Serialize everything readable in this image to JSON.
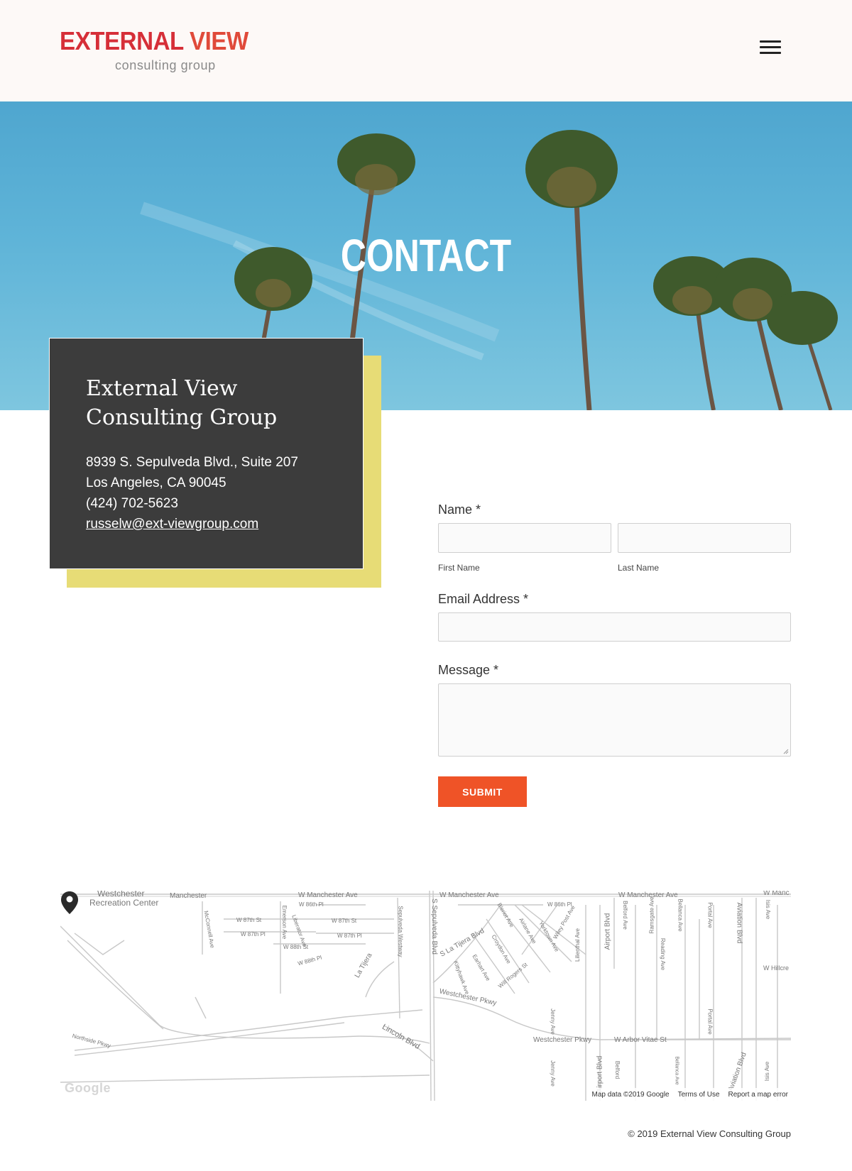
{
  "header": {
    "logo_text_1": "EXTERNAL",
    "logo_text_2": "VIEW",
    "logo_subtitle": "consulting group",
    "menu_icon": "hamburger-menu-icon"
  },
  "hero": {
    "title": "CONTACT"
  },
  "info_card": {
    "title": "External View Consulting Group",
    "address_line_1": "8939 S. Sepulveda Blvd., Suite 207",
    "address_line_2": "Los Angeles, CA 90045",
    "phone": "(424) 702-5623",
    "email": "russelw@ext-viewgroup.com"
  },
  "form": {
    "name_label": "Name *",
    "first_name_label": "First Name",
    "last_name_label": "Last Name",
    "email_label": "Email Address *",
    "message_label": "Message *",
    "submit_label": "SUBMIT"
  },
  "map": {
    "google_logo": "Google",
    "attribution": [
      "Map data ©2019 Google",
      "Terms of Use",
      "Report a map error"
    ],
    "pin_icon": "map-pin-icon",
    "labels": {
      "westchester_rec": "Westchester",
      "rec_center": "Recreation Center",
      "manchester": "Manchester",
      "w_manchester_1": "W Manchester Ave",
      "w_manchester_2": "W Manchester Ave",
      "w_manchester_3": "W Manchester Ave",
      "w_manc": "W Manc",
      "w_86th_pl_1": "W 86th Pl",
      "w_86th_pl_2": "W 86th Pl",
      "w_87th_st_1": "W 87th St",
      "w_87th_pl_1": "W 87th Pl",
      "w_87th_st_2": "W 87th St",
      "w_87th_pl_2": "W 87th Pl",
      "w_88th_st": "W 88th St",
      "w_88th_pl": "W 88th Pl",
      "s_sepulveda": "S Sepulveda Blvd",
      "sepulveda_westway": "Sepulveda Westway",
      "s_la_tijera": "S La Tijera Blvd",
      "la_tijera": "La Tijera",
      "westchester_pkwy_1": "Westchester Pkwy",
      "westchester_pkwy_2": "Westchester Pkwy",
      "w_arbor_vitae": "W Arbor Vitae St",
      "lincoln_blvd": "Lincoln Blvd",
      "airport_blvd_1": "Airport Blvd",
      "airport_blvd_2": "Airport Blvd",
      "aviation_blvd_1": "Aviation Blvd",
      "aviation_blvd_2": "Aviation Blvd",
      "w_hillcrest": "W Hillcre",
      "northside_pkwy": "Northside Pkwy",
      "mcconnell": "McConnell Ave",
      "emerson": "Emerson Ave",
      "liberator": "Liberator Ave",
      "bleriot": "Bleriot Ave",
      "croydon": "Croydon Ave",
      "earhart": "Earhart Ave",
      "will_rogers": "Will Rogers St",
      "airlane": "Airlane Ave",
      "yorktown": "Yorktown Ave",
      "wiley_post": "Wiley Post Ave",
      "lilienthal": "Lilienthal Ave",
      "belford_1": "Belford Ave",
      "belford_2": "Belford",
      "ramsgate": "Ramsgate Ave",
      "bellanca_1": "Bellanca Ave",
      "bellanca_2": "Bellanca Ave",
      "reading": "Reading Ave",
      "portal_1": "Portal Ave",
      "portal_2": "Portal Ave",
      "isis_1": "Isis Ave",
      "isis_2": "Isis Ave",
      "jenny_1": "Jenny Ave",
      "jenny_2": "Jenny Ave",
      "kittyhawk": "Kittyhawk Ave"
    }
  },
  "footer": {
    "copyright": "© 2019 External View Consulting Group"
  },
  "colors": {
    "accent": "#ef5327",
    "logo_red": "#d62f38",
    "card_bg": "#3c3c3c",
    "card_shadow": "#e7dc76",
    "header_bg": "#fdf9f7"
  }
}
